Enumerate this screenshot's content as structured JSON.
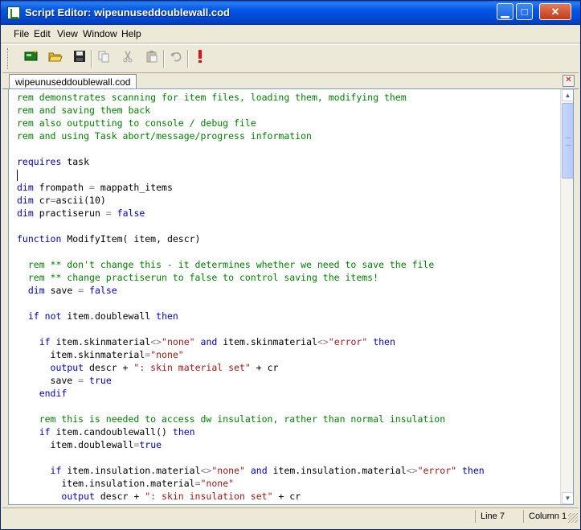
{
  "window": {
    "title": "Script Editor: wipeunuseddoublewall.cod",
    "controls": {
      "minimize": "▁",
      "maximize": "□",
      "close": "✕"
    }
  },
  "menu": {
    "file": "File",
    "edit": "Edit",
    "view": "View",
    "window": "Window",
    "help": "Help"
  },
  "toolbar": {
    "new_icon": "new-script-icon",
    "open_icon": "open-folder-icon",
    "save_icon": "save-disk-icon",
    "copy_icon": "copy-icon",
    "cut_icon": "cut-icon",
    "paste_icon": "paste-icon",
    "undo_icon": "undo-icon",
    "run_icon": "run-exclamation-icon"
  },
  "tabs": [
    {
      "label": "wipeunuseddoublewall.cod",
      "active": true
    }
  ],
  "tab_close": "✕",
  "code_lines": [
    "rem demonstrates scanning for item files, loading them, modifying them",
    "rem and saving them back",
    "rem also outputting to console / debug file",
    "rem and using Task abort/message/progress information",
    "",
    "requires task",
    "",
    "dim frompath = mappath_items",
    "dim cr=ascii(10)",
    "dim practiserun = false",
    "",
    "function ModifyItem( item, descr)",
    "",
    "  rem ** don't change this - it determines whether we need to save the file",
    "  rem ** change practiserun to false to control saving the items!",
    "  dim save = false",
    "",
    "  if not item.doublewall then",
    "",
    "    if item.skinmaterial<>\"none\" and item.skinmaterial<>\"error\" then",
    "      item.skinmaterial=\"none\"",
    "      output descr + \": skin material set\" + cr",
    "      save = true",
    "    endif",
    "",
    "    rem this is needed to access dw insulation, rather than normal insulation",
    "    if item.candoublewall() then",
    "      item.doublewall=true",
    "",
    "      if item.insulation.material<>\"none\" and item.insulation.material<>\"error\" then",
    "        item.insulation.material=\"none\"",
    "        output descr + \": skin insulation set\" + cr"
  ],
  "status": {
    "line": "Line 7",
    "column": "Column 1"
  },
  "colors": {
    "comment": "#008000",
    "keyword": "#0000c0",
    "string": "#a31515",
    "operator": "#808080",
    "titlebar": "#0055e5"
  }
}
